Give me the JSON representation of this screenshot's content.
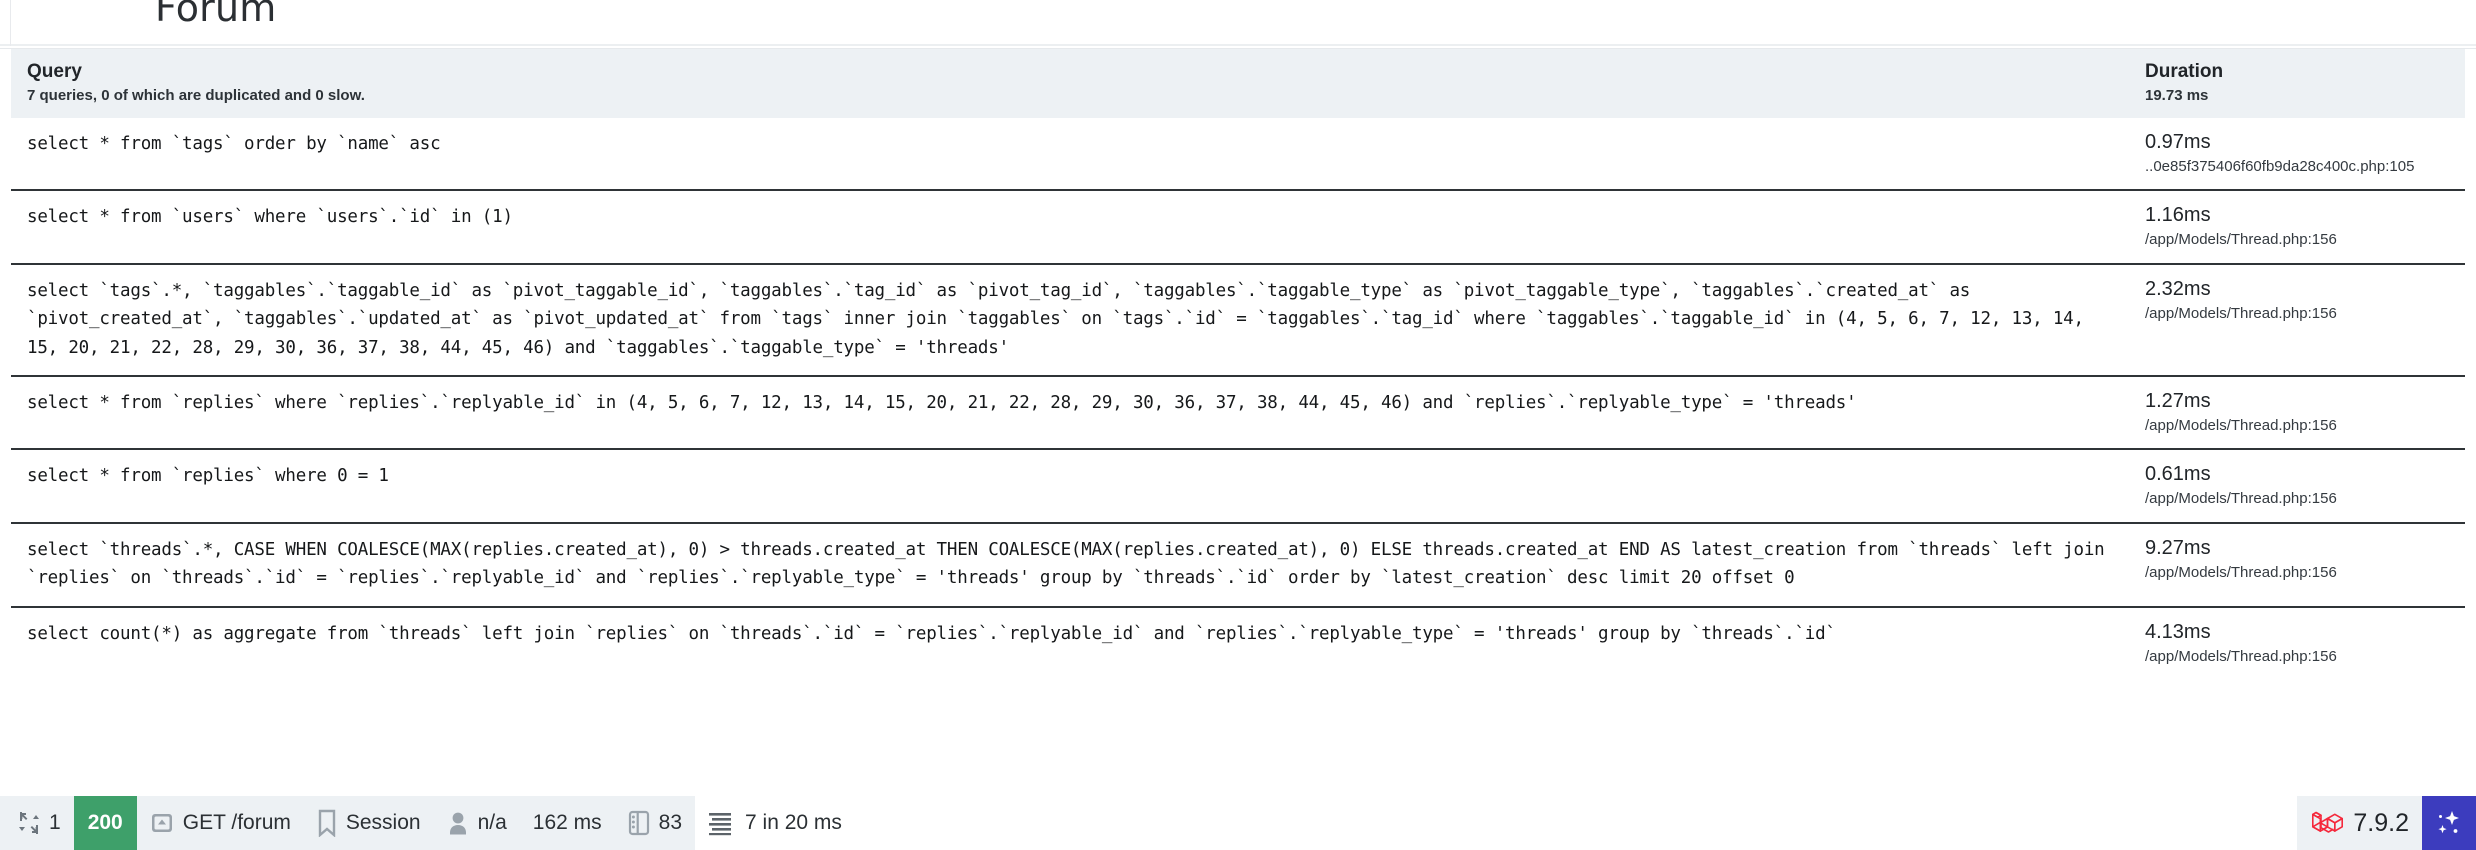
{
  "site": {
    "brand": "Forum"
  },
  "debugbar": {
    "columns": {
      "query": "Query",
      "query_summary": "7 queries, 0 of which are duplicated and 0 slow.",
      "duration": "Duration",
      "duration_total": "19.73 ms"
    },
    "rows": [
      {
        "sql": "select * from `tags` order by `name` asc",
        "time": "0.97ms",
        "source": "..0e85f375406f60fb9da28c400c.php:105"
      },
      {
        "sql": "select * from `users` where `users`.`id` in (1)",
        "time": "1.16ms",
        "source": "/app/Models/Thread.php:156"
      },
      {
        "sql": "select `tags`.*, `taggables`.`taggable_id` as `pivot_taggable_id`, `taggables`.`tag_id` as `pivot_tag_id`, `taggables`.`taggable_type` as `pivot_taggable_type`, `taggables`.`created_at` as `pivot_created_at`, `taggables`.`updated_at` as `pivot_updated_at` from `tags` inner join `taggables` on `tags`.`id` = `taggables`.`tag_id` where `taggables`.`taggable_id` in (4, 5, 6, 7, 12, 13, 14, 15, 20, 21, 22, 28, 29, 30, 36, 37, 38, 44, 45, 46) and `taggables`.`taggable_type` = 'threads'",
        "time": "2.32ms",
        "source": "/app/Models/Thread.php:156"
      },
      {
        "sql": "select * from `replies` where `replies`.`replyable_id` in (4, 5, 6, 7, 12, 13, 14, 15, 20, 21, 22, 28, 29, 30, 36, 37, 38, 44, 45, 46) and `replies`.`replyable_type` = 'threads'",
        "time": "1.27ms",
        "source": "/app/Models/Thread.php:156"
      },
      {
        "sql": "select * from `replies` where 0 = 1",
        "time": "0.61ms",
        "source": "/app/Models/Thread.php:156"
      },
      {
        "sql": "select `threads`.*, CASE WHEN COALESCE(MAX(replies.created_at), 0) > threads.created_at THEN COALESCE(MAX(replies.created_at), 0) ELSE threads.created_at END AS latest_creation from `threads` left join `replies` on `threads`.`id` = `replies`.`replyable_id` and `replies`.`replyable_type` = 'threads' group by `threads`.`id` order by `latest_creation` desc limit 20 offset 0",
        "time": "9.27ms",
        "source": "/app/Models/Thread.php:156"
      },
      {
        "sql": "select count(*) as aggregate from `threads` left join `replies` on `threads`.`id` = `replies`.`replyable_id` and `replies`.`replyable_type` = 'threads' group by `threads`.`id`",
        "time": "4.13ms",
        "source": "/app/Models/Thread.php:156"
      }
    ]
  },
  "statusbar": {
    "messages_count": "1",
    "messages_icon": "exchange-icon",
    "status_code": "200",
    "status_color": "#3ea06a",
    "route_icon": "route-icon",
    "route": "GET /forum",
    "session_icon": "bookmark-icon",
    "session": "Session",
    "user_icon": "user-icon",
    "user": "n/a",
    "timeline": "162 ms",
    "memory_icon": "memory-icon",
    "memory": "83",
    "queries_icon": "database-list-icon",
    "queries": "7 in 20 ms",
    "laravel_icon": "laravel-logo-icon",
    "laravel_version": "7.9.2",
    "sparkle_icon": "sparkle-icon",
    "sparkle_color": "#3c3cbe"
  }
}
